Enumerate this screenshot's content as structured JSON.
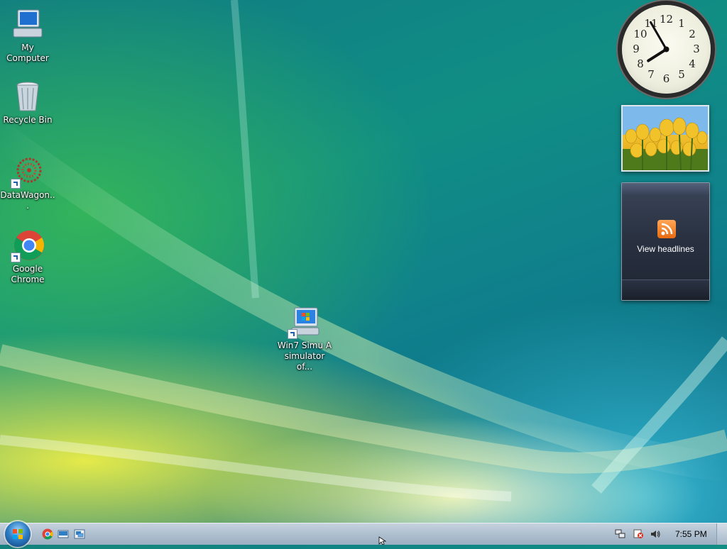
{
  "desktop": {
    "icons": [
      {
        "label": "My Computer",
        "icon": "computer-icon"
      },
      {
        "label": "Recycle Bin",
        "icon": "recycle-bin-icon"
      },
      {
        "label": "DataWagon...",
        "icon": "datawagon-icon"
      },
      {
        "label": "Google Chrome",
        "icon": "chrome-icon"
      },
      {
        "label": "Win7 Simu   A simulator of...",
        "icon": "win7-simulator-icon"
      }
    ]
  },
  "gadgets": {
    "clock": {
      "hour": 7,
      "minute": 55,
      "numbers": [
        "12",
        "1",
        "2",
        "3",
        "4",
        "5",
        "6",
        "7",
        "8",
        "9",
        "10",
        "11"
      ]
    },
    "slideshow": {
      "icon": "slideshow-photo"
    },
    "feed": {
      "label": "View headlines",
      "icon": "rss-icon"
    }
  },
  "taskbar": {
    "start_icon": "start-orb-icon",
    "quick_launch": [
      "chrome-icon",
      "show-desktop-icon",
      "switch-windows-icon"
    ],
    "tray_icons": [
      "network-icon",
      "security-alert-icon",
      "volume-icon"
    ],
    "time": "7:55 PM"
  },
  "colors": {
    "wallpaper": "#0f7f8c",
    "taskbar": "#aebfcf",
    "rss_accent": "#e86a10"
  }
}
